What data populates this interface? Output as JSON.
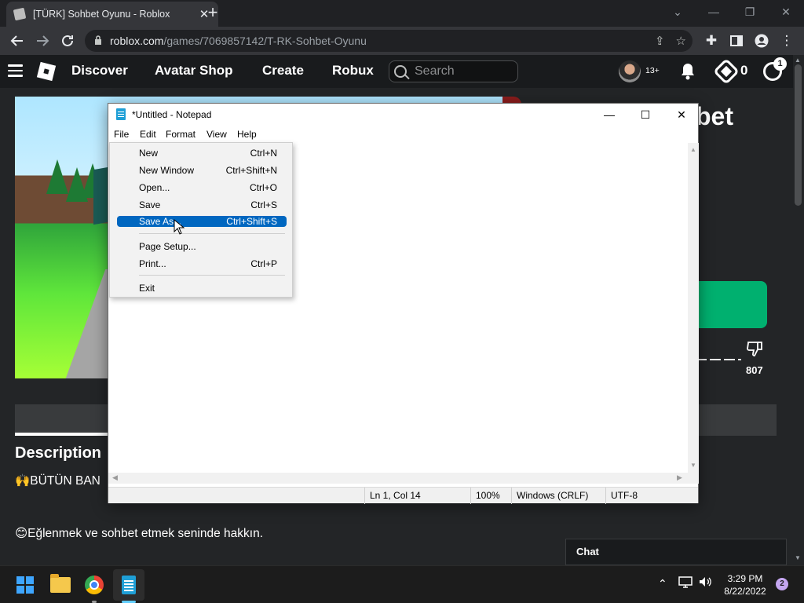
{
  "browser": {
    "tab_title": "[TÜRK] Sohbet Oyunu - Roblox",
    "tab_close": "✕",
    "new_tab": "+",
    "window_controls": [
      "⌄",
      "—",
      "❐",
      "✕"
    ],
    "url_host": "roblox.com",
    "url_path": "/games/7069857142/T-RK-Sohbet-Oyunu"
  },
  "roblox": {
    "nav": [
      "Discover",
      "Avatar Shop",
      "Create",
      "Robux"
    ],
    "search_placeholder": "Search",
    "age_label": "13+",
    "robux_count": "0",
    "settings_badge": "1",
    "game_title_fragment": "bet",
    "vote_fragment": "",
    "dislike_count": "807",
    "description_heading": "Description",
    "description_line1": "🙌BÜTÜN BAN",
    "description_line2": "😊Eğlenmek ve sohbet etmek seninde hakkın.",
    "chat_label": "Chat"
  },
  "notepad": {
    "title": "*Untitled - Notepad",
    "menus": [
      "File",
      "Edit",
      "Format",
      "View",
      "Help"
    ],
    "controls": [
      "—",
      "☐",
      "✕"
    ],
    "status": {
      "position": "Ln 1, Col 14",
      "zoom": "100%",
      "line_ending": "Windows (CRLF)",
      "encoding": "UTF-8"
    },
    "file_menu": [
      {
        "label": "New",
        "shortcut": "Ctrl+N"
      },
      {
        "label": "New Window",
        "shortcut": "Ctrl+Shift+N"
      },
      {
        "label": "Open...",
        "shortcut": "Ctrl+O"
      },
      {
        "label": "Save",
        "shortcut": "Ctrl+S"
      },
      {
        "label": "Save As...",
        "shortcut": "Ctrl+Shift+S"
      },
      {
        "label": "Page Setup...",
        "shortcut": ""
      },
      {
        "label": "Print...",
        "shortcut": "Ctrl+P"
      },
      {
        "label": "Exit",
        "shortcut": ""
      }
    ],
    "selected_item": "Save As..."
  },
  "taskbar": {
    "time": "3:29 PM",
    "date": "8/22/2022",
    "notification_count": "2"
  },
  "colors": {
    "accent_selection": "#0067c0",
    "roblox_play_green": "#00b06f",
    "page_bg": "#232527"
  },
  "icons": [
    "back-icon",
    "forward-icon",
    "reload-icon",
    "lock-icon",
    "share-icon",
    "star-icon",
    "extensions-icon",
    "sidebar-icon",
    "profile-icon",
    "menu-icon",
    "search-icon",
    "bell-icon",
    "robux-icon",
    "gear-icon",
    "thumbs-down-icon",
    "windows-start-icon",
    "folder-icon",
    "chrome-icon",
    "notepad-icon",
    "cursor-icon"
  ]
}
